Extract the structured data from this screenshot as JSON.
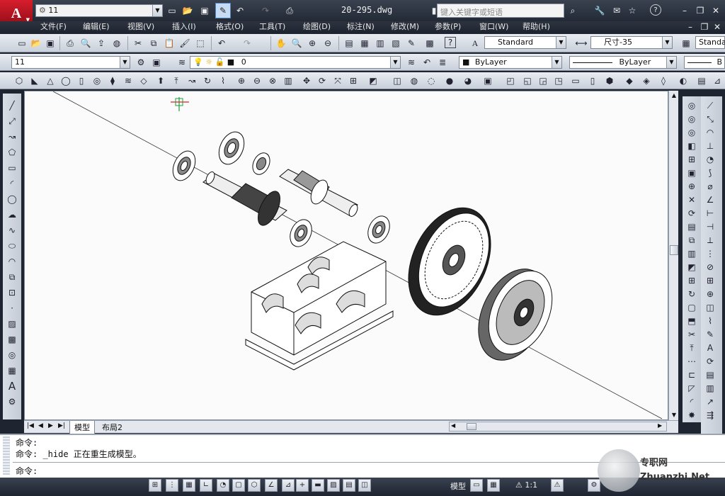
{
  "app": {
    "title": "20-295.dwg",
    "workspace": "11",
    "search_placeholder": "键入关键字或短语",
    "watermark": "专职网 Zhuanzhi.Net"
  },
  "menu": {
    "items": [
      "文件(F)",
      "编辑(E)",
      "视图(V)",
      "插入(I)",
      "格式(O)",
      "工具(T)",
      "绘图(D)",
      "标注(N)",
      "修改(M)",
      "参数(P)",
      "窗口(W)",
      "帮助(H)"
    ]
  },
  "styles": {
    "text_style": "Standard",
    "dim_style": "尺寸-35",
    "table_style": "Standa"
  },
  "layers": {
    "workspace_combo": "11",
    "current_layer": "0",
    "color": "ByLayer",
    "linetype": "ByLayer",
    "lineweight": "B"
  },
  "tabs": {
    "model": "模型",
    "layout": "布局2"
  },
  "command": {
    "line1": "命令:",
    "line2": "命令: _hide 正在重生成模型。",
    "prompt": "命令:"
  },
  "status": {
    "model_label": "模型",
    "scale_label": "1:1"
  },
  "colors": {
    "chrome": "#2a313c",
    "toolbar": "#d5dbe3",
    "canvas": "#fbfbfb",
    "accent": "#c8102e"
  },
  "icons": [
    "autocad-logo",
    "new-icon",
    "open-icon",
    "save-icon",
    "saveas-icon",
    "undo-icon",
    "redo-icon",
    "print-icon",
    "search-icon",
    "binoculars-icon",
    "wrench-icon",
    "star-icon",
    "help-icon",
    "minimize-icon",
    "restore-icon",
    "close-icon"
  ]
}
